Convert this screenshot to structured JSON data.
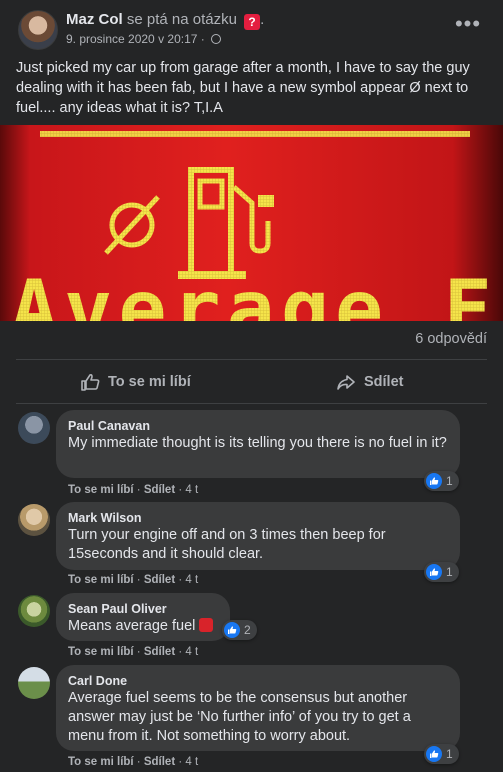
{
  "post": {
    "author": "Maz Col",
    "action": "se ptá na otázku",
    "badge": "?",
    "badge_suffix": ".",
    "date": "9. prosince 2020 v 20:17 ·",
    "more_icon": "more-horizontal-icon",
    "text": "Just picked my car up from garage after a month, I have to say the guy dealing with it has been fab, but I have a new symbol appear Ø next to fuel.... any ideas what it is? T,I.A",
    "image_text": "Average Fuel",
    "answers_count": "6 odpovědí",
    "like_label": "To se mi líbí",
    "share_label": "Sdílet"
  },
  "comments": [
    {
      "name": "Paul Canavan",
      "text": "My immediate thought is its telling you there is no fuel in it?",
      "like": "To se mi líbí",
      "share": "Sdílet",
      "time": "4 t",
      "reactions": "1"
    },
    {
      "name": "Mark Wilson",
      "text": "Turn your engine off and on 3 times then beep for 15seconds and it should clear.",
      "like": "To se mi líbí",
      "share": "Sdílet",
      "time": "4 t",
      "reactions": "1"
    },
    {
      "name": "Sean Paul Oliver",
      "text": "Means average fuel",
      "like": "To se mi líbí",
      "share": "Sdílet",
      "time": "4 t",
      "reactions": "2"
    },
    {
      "name": "Carl Done",
      "text": "Average fuel seems to be the consensus but another answer may just be ‘No further info’ of you try to get a menu from it. Not something to worry about.",
      "like": "To se mi líbí",
      "share": "Sdílet",
      "time": "4 t",
      "reactions": "1"
    }
  ],
  "colors": {
    "background": "#242526",
    "bubble": "#3a3b3c",
    "text": "#e4e6eb",
    "muted": "#b0b3b8",
    "like_blue": "#1877f2",
    "question_red": "#e41e3f",
    "display_yellow": "#f5e44a"
  }
}
